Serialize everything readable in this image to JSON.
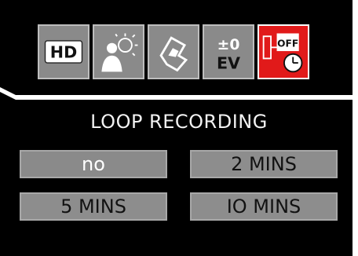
{
  "menu": {
    "tabs": [
      {
        "icon": "hd-resolution-icon",
        "label": "HD",
        "active": false
      },
      {
        "icon": "white-balance-icon",
        "active": false
      },
      {
        "icon": "drive-mode-icon",
        "active": false
      },
      {
        "icon": "exposure-value-icon",
        "label_top": "±0",
        "label_bottom": "EV",
        "active": false
      },
      {
        "icon": "auto-off-timer-icon",
        "label": "OFF",
        "active": true
      }
    ]
  },
  "panel": {
    "title": "LOOP RECORDING",
    "options": [
      {
        "label": "no",
        "selected": true
      },
      {
        "label": "2 MINS",
        "selected": false
      },
      {
        "label": "5 MINS",
        "selected": false
      },
      {
        "label": "IO MINS",
        "selected": false
      }
    ]
  },
  "colors": {
    "background": "#000000",
    "tab_inactive": "#8a8a8a",
    "tab_active": "#e11a1a",
    "option_bg": "#8d8d8d",
    "text": "#f2f2f2"
  }
}
